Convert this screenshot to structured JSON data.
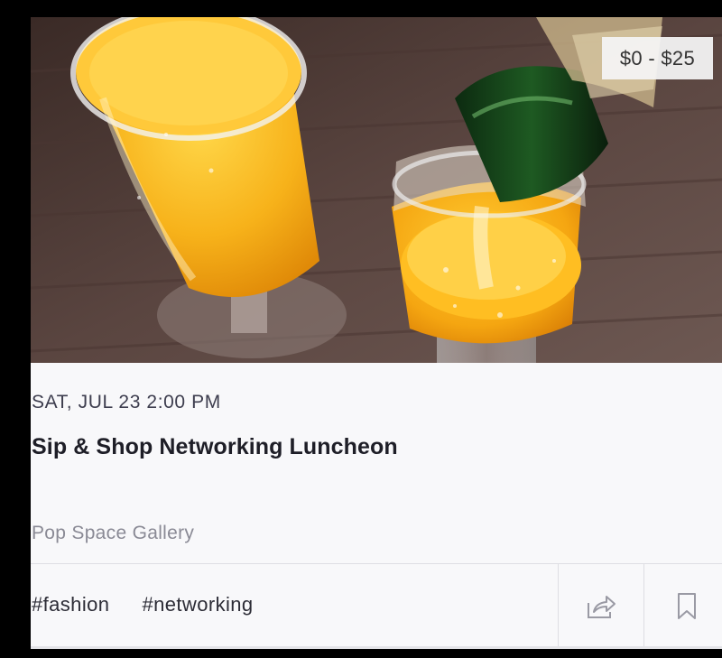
{
  "event": {
    "price": "$0 - $25",
    "date": "SAT, JUL 23 2:00 PM",
    "title": "Sip & Shop Networking Luncheon",
    "venue": "Pop Space Gallery",
    "tags": [
      "#fashion",
      "#networking"
    ]
  },
  "icons": {
    "share": "share-icon",
    "bookmark": "bookmark-icon"
  }
}
